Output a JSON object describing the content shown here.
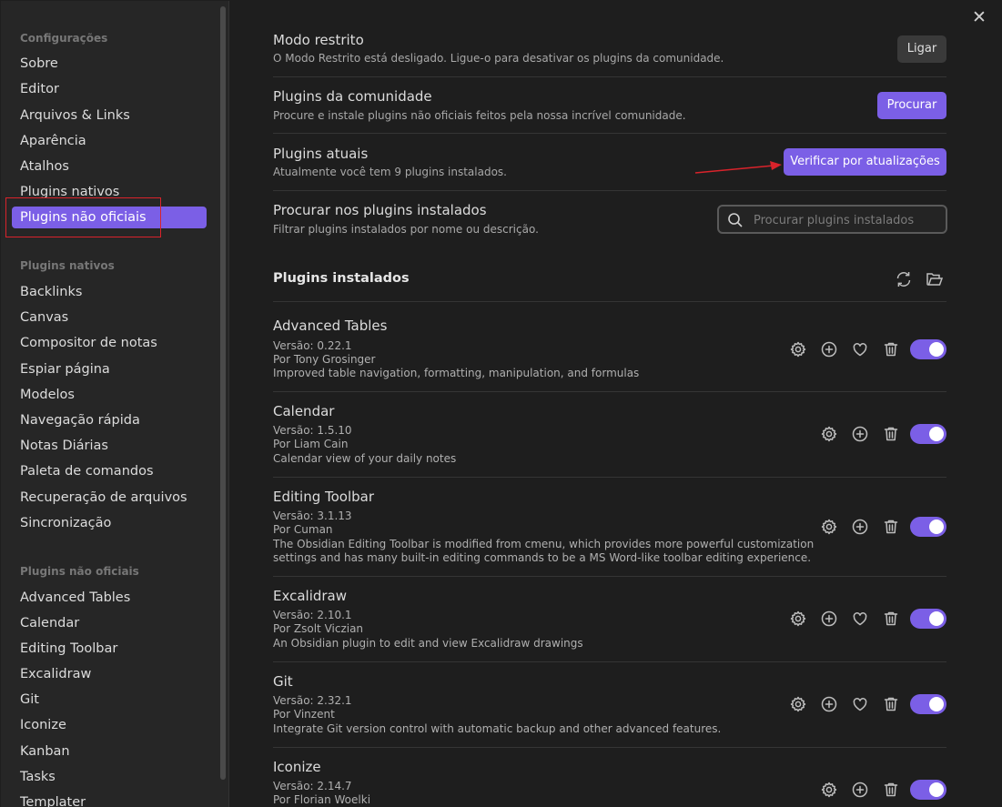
{
  "sidebar": {
    "group1": "Configurações",
    "group1_items": [
      "Sobre",
      "Editor",
      "Arquivos & Links",
      "Aparência",
      "Atalhos",
      "Plugins nativos",
      "Plugins não oficiais"
    ],
    "group2": "Plugins nativos",
    "group2_items": [
      "Backlinks",
      "Canvas",
      "Compositor de notas",
      "Espiar página",
      "Modelos",
      "Navegação rápida",
      "Notas Diárias",
      "Paleta de comandos",
      "Recuperação de arquivos",
      "Sincronização"
    ],
    "group3": "Plugins não oficiais",
    "group3_items": [
      "Advanced Tables",
      "Calendar",
      "Editing Toolbar",
      "Excalidraw",
      "Git",
      "Iconize",
      "Kanban",
      "Tasks",
      "Templater"
    ]
  },
  "settings": {
    "restricted": {
      "title": "Modo restrito",
      "desc": "O Modo Restrito está desligado. Ligue-o para desativar os plugins da comunidade.",
      "button": "Ligar"
    },
    "community": {
      "title": "Plugins da comunidade",
      "desc": "Procure e instale plugins não oficiais feitos pela nossa incrível comunidade.",
      "button": "Procurar"
    },
    "current": {
      "title": "Plugins atuais",
      "desc": "Atualmente você tem 9 plugins instalados.",
      "button": "Verificar por atualizações"
    },
    "search": {
      "title": "Procurar nos plugins instalados",
      "desc": "Filtrar plugins instalados por nome ou descrição.",
      "placeholder": "Procurar plugins instalados"
    }
  },
  "installed": {
    "heading": "Plugins instalados",
    "plugins": [
      {
        "name": "Advanced Tables",
        "version": "Versão: 0.22.1",
        "author": "Por Tony Grosinger",
        "desc": "Improved table navigation, formatting, manipulation, and formulas",
        "enabled": true
      },
      {
        "name": "Calendar",
        "version": "Versão: 1.5.10",
        "author": "Por Liam Cain",
        "desc": "Calendar view of your daily notes",
        "enabled": true
      },
      {
        "name": "Editing Toolbar",
        "version": "Versão: 3.1.13",
        "author": "Por Cuman",
        "desc": "The Obsidian Editing Toolbar is modified from cmenu, which provides more powerful customization",
        "desc2": "settings and has many built-in editing commands to be a MS Word-like toolbar editing experience.",
        "enabled": true
      },
      {
        "name": "Excalidraw",
        "version": "Versão: 2.10.1",
        "author": "Por Zsolt Viczian",
        "desc": "An Obsidian plugin to edit and view Excalidraw drawings",
        "enabled": true
      },
      {
        "name": "Git",
        "version": "Versão: 2.32.1",
        "author": "Por Vinzent",
        "desc": "Integrate Git version control with automatic backup and other advanced features.",
        "enabled": true
      },
      {
        "name": "Iconize",
        "version": "Versão: 2.14.7",
        "author": "Por Florian Woelki",
        "enabled": true
      }
    ]
  },
  "icons": {
    "close": "close-icon",
    "search": "search-icon",
    "reload": "reload-icon",
    "folder": "folder-icon",
    "gear": "gear-icon",
    "plus": "plus-circle-icon",
    "heart": "heart-icon",
    "trash": "trash-icon"
  },
  "colors": {
    "accent": "#7b5fe6",
    "annotation": "#d9232b"
  }
}
